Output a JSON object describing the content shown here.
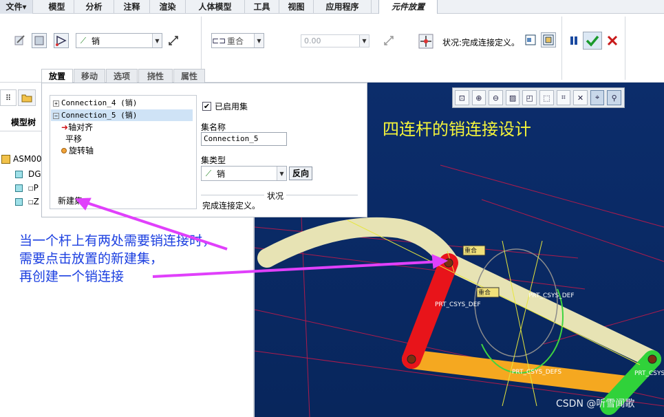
{
  "menu": {
    "file_label": "文件",
    "file_arrow": "▾",
    "tabs": [
      "模型",
      "分析",
      "注释",
      "渲染",
      "人体模型",
      "工具",
      "视图",
      "应用程序"
    ],
    "active_tab": "元件放置"
  },
  "ribbon": {
    "constraint_type": "销",
    "constraint_option": "重合",
    "offset_value": "0.00",
    "status_label": "状况:完成连接定义。",
    "icons": [
      "user-defined-icon",
      "placement-icon",
      "mechanism-icon",
      "flip-icon",
      "offset-icon",
      "flip-offset-icon",
      "drag-icon",
      "window-icon",
      "window-separate-icon",
      "pause-icon",
      "confirm-icon",
      "cancel-icon"
    ]
  },
  "subtabs": [
    "放置",
    "移动",
    "选项",
    "挠性",
    "属性"
  ],
  "panel": {
    "sets": [
      {
        "label": "Connection_4 (销)",
        "toggle": "+"
      },
      {
        "label": "Connection_5 (销)",
        "toggle": "−"
      }
    ],
    "children": [
      "轴对齐",
      "平移",
      "旋转轴"
    ],
    "new_set_label": "新建集",
    "enabled_label": "已启用集",
    "enabled": true,
    "set_name_label": "集名称",
    "set_name_value": "Connection_5",
    "set_type_label": "集类型",
    "set_type_value": "销",
    "flip_button": "反向",
    "status_header": "状况",
    "status_text": "完成连接定义。"
  },
  "model_tree": {
    "tab_label": "模型树",
    "root": "ASM00",
    "items": [
      "DG",
      "P",
      "Z"
    ]
  },
  "viewport": {
    "title_annotation": "四连杆的销连接设计",
    "labels": {
      "coincident": "重合",
      "csys1": "PRT_CSYS_DEF",
      "csys2": "PRT_CSYS_DEF",
      "csys3": "PRT_CSYS_DEFS",
      "csys4": "PRT_CSYS"
    },
    "toolbar_icons": [
      "zoom-fit-icon",
      "zoom-in-icon",
      "zoom-out-icon",
      "repaint-icon",
      "display-style-icon",
      "saved-orientation-icon",
      "view-manager-icon",
      "datum-display-icon",
      "spin-center-icon",
      "connect-icon"
    ]
  },
  "annotation": {
    "lines": [
      "当一个杆上有两处需要销连接时，",
      "需要点击放置的新建集，",
      "再创建一个销连接"
    ]
  },
  "watermark": "CSDN @听雪闻歌",
  "colors": {
    "annotation_text": "#1b3fe0",
    "title_text": "#f5f53a",
    "arrow": "#e040fb",
    "viewport_bg": "#0a2a66",
    "red_link": "#e8141a",
    "orange_link": "#f5a820",
    "green_link": "#30d23a",
    "beige_link": "#e7e3b4"
  }
}
